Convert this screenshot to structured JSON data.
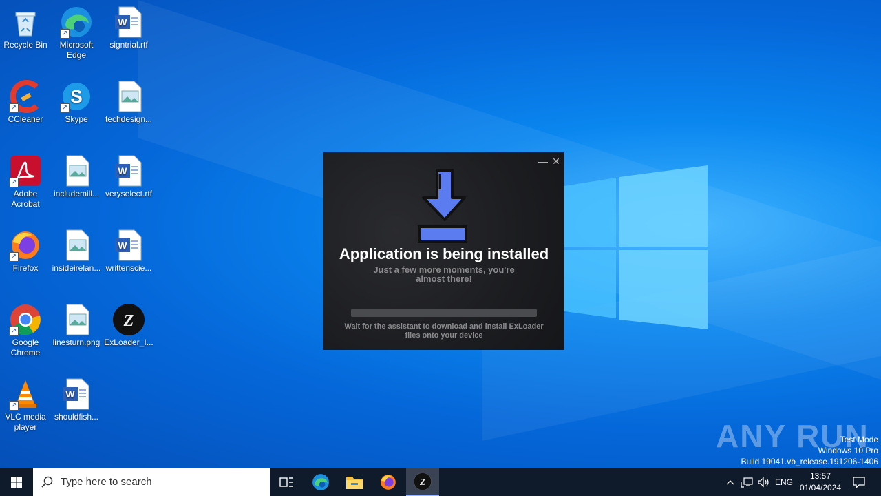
{
  "desktop": {
    "icons": [
      {
        "label": "Recycle Bin"
      },
      {
        "label": "Microsoft Edge"
      },
      {
        "label": "signtrial.rtf"
      },
      {
        "label": "CCleaner"
      },
      {
        "label": "Skype"
      },
      {
        "label": "techdesign..."
      },
      {
        "label": "Adobe Acrobat"
      },
      {
        "label": "includemill..."
      },
      {
        "label": "veryselect.rtf"
      },
      {
        "label": "Firefox"
      },
      {
        "label": "insideirelan..."
      },
      {
        "label": "writtenscie..."
      },
      {
        "label": "Google Chrome"
      },
      {
        "label": "linesturn.png"
      },
      {
        "label": "ExLoader_I..."
      },
      {
        "label": "VLC media player"
      },
      {
        "label": "shouldfish..."
      }
    ]
  },
  "dialog": {
    "title": "Application is being installed",
    "subtitle": "Just a few more moments, you're almost there!",
    "hint": "Wait for the assistant to download and install ExLoader files onto your device",
    "minimize": "—",
    "close": "✕",
    "progress_percent": 0
  },
  "watermark": {
    "logo": "ANY RUN",
    "line1": "Test Mode",
    "line2": "Windows 10 Pro",
    "line3": "Build 19041.vb_release.191206-1406"
  },
  "taskbar": {
    "search_placeholder": "Type here to search",
    "language": "ENG",
    "time": "13:57",
    "date": "01/04/2024",
    "pinned": [
      "task-view",
      "edge",
      "file-explorer",
      "firefox",
      "exloader"
    ]
  },
  "colors": {
    "taskbar": "#0f1a2b",
    "accent": "#5b7cf0",
    "dialog_bg": "#1e1f22"
  }
}
